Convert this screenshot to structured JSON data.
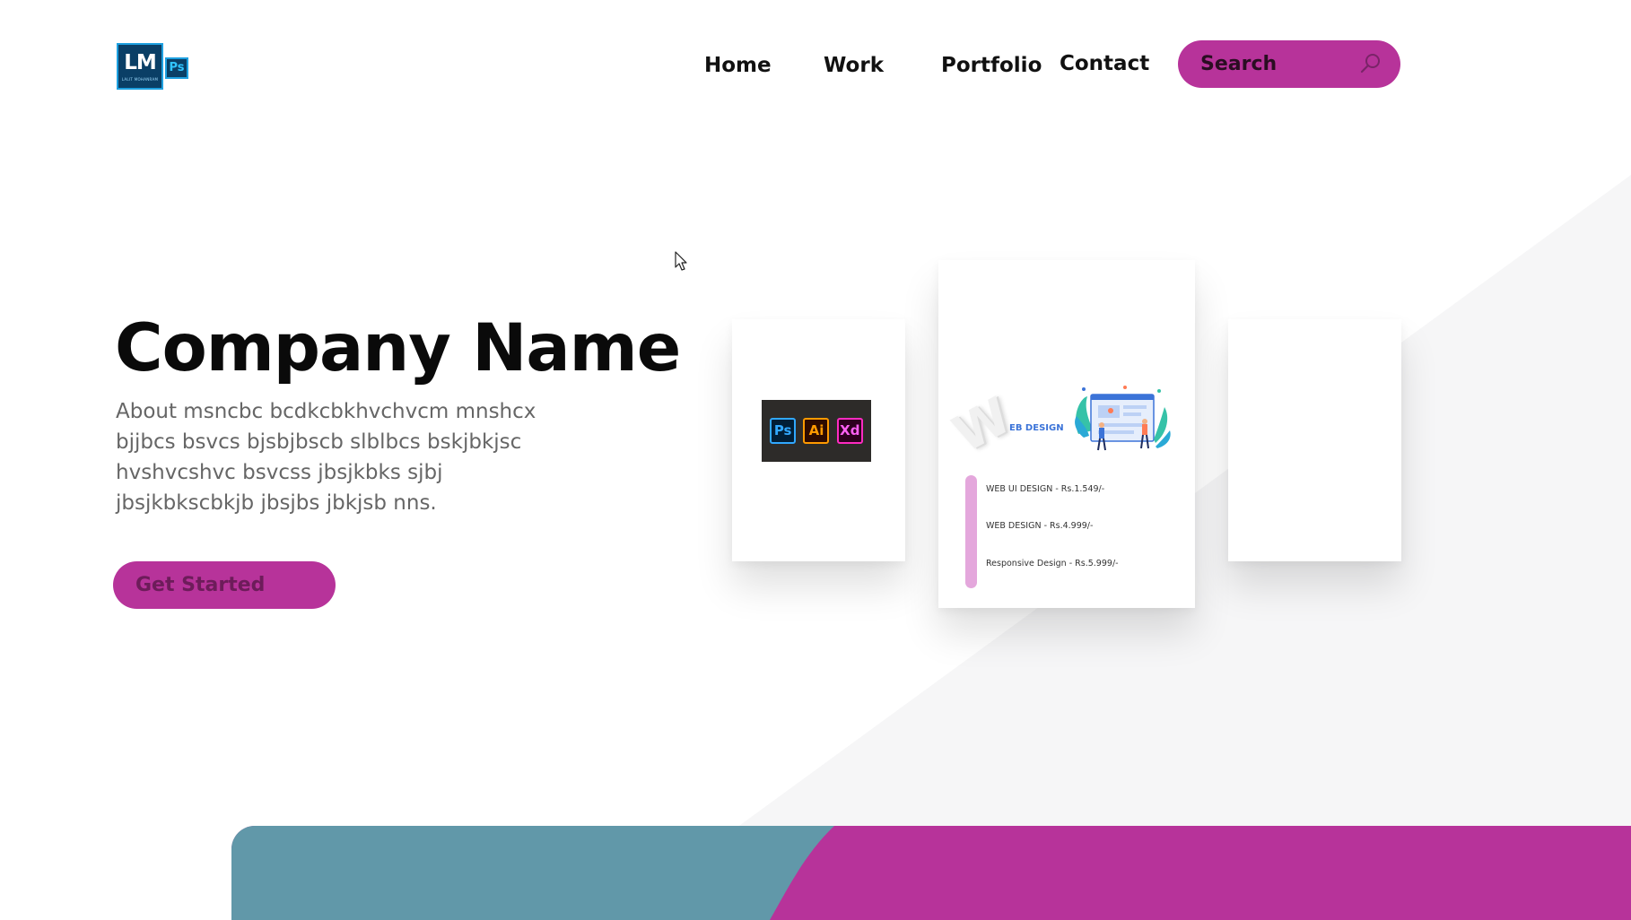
{
  "logo": {
    "main": "LM",
    "badge": "Ps",
    "subtext": "LALIT MOHANRAM"
  },
  "nav": {
    "items": [
      {
        "label": "Home"
      },
      {
        "label": "Work"
      },
      {
        "label": "Portfolio"
      },
      {
        "label": "Contact"
      }
    ]
  },
  "search": {
    "label": "Search",
    "icon": "search-icon"
  },
  "hero": {
    "title": "Company Name",
    "about_lines": [
      "About msncbc bcdkcbkhvchvcm mnshcx",
      "bjjbcs bsvcs bjsbjbscb slblbcs bskjbkjsc",
      "hvshvcshvc bsvcss jbsjkbks sjbj",
      "jbsjkbkscbkjb jbsjbs jbkjsb nns."
    ],
    "cta_label": "Get Started"
  },
  "cards": {
    "apps": [
      "Ps",
      "Ai",
      "Xd"
    ],
    "web_design": {
      "big_letter": "W",
      "label": "EB DESIGN"
    },
    "prices": [
      "WEB UI DESIGN - Rs.1.549/-",
      "WEB DESIGN - Rs.4.999/-",
      "Responsive Design - Rs.5.999/-"
    ]
  },
  "colors": {
    "accent_magenta": "#b7339a",
    "teal": "#6198a9",
    "price_bar": "#e4a7dc",
    "text_dark": "#0a0a0a",
    "text_gray": "#666666"
  }
}
